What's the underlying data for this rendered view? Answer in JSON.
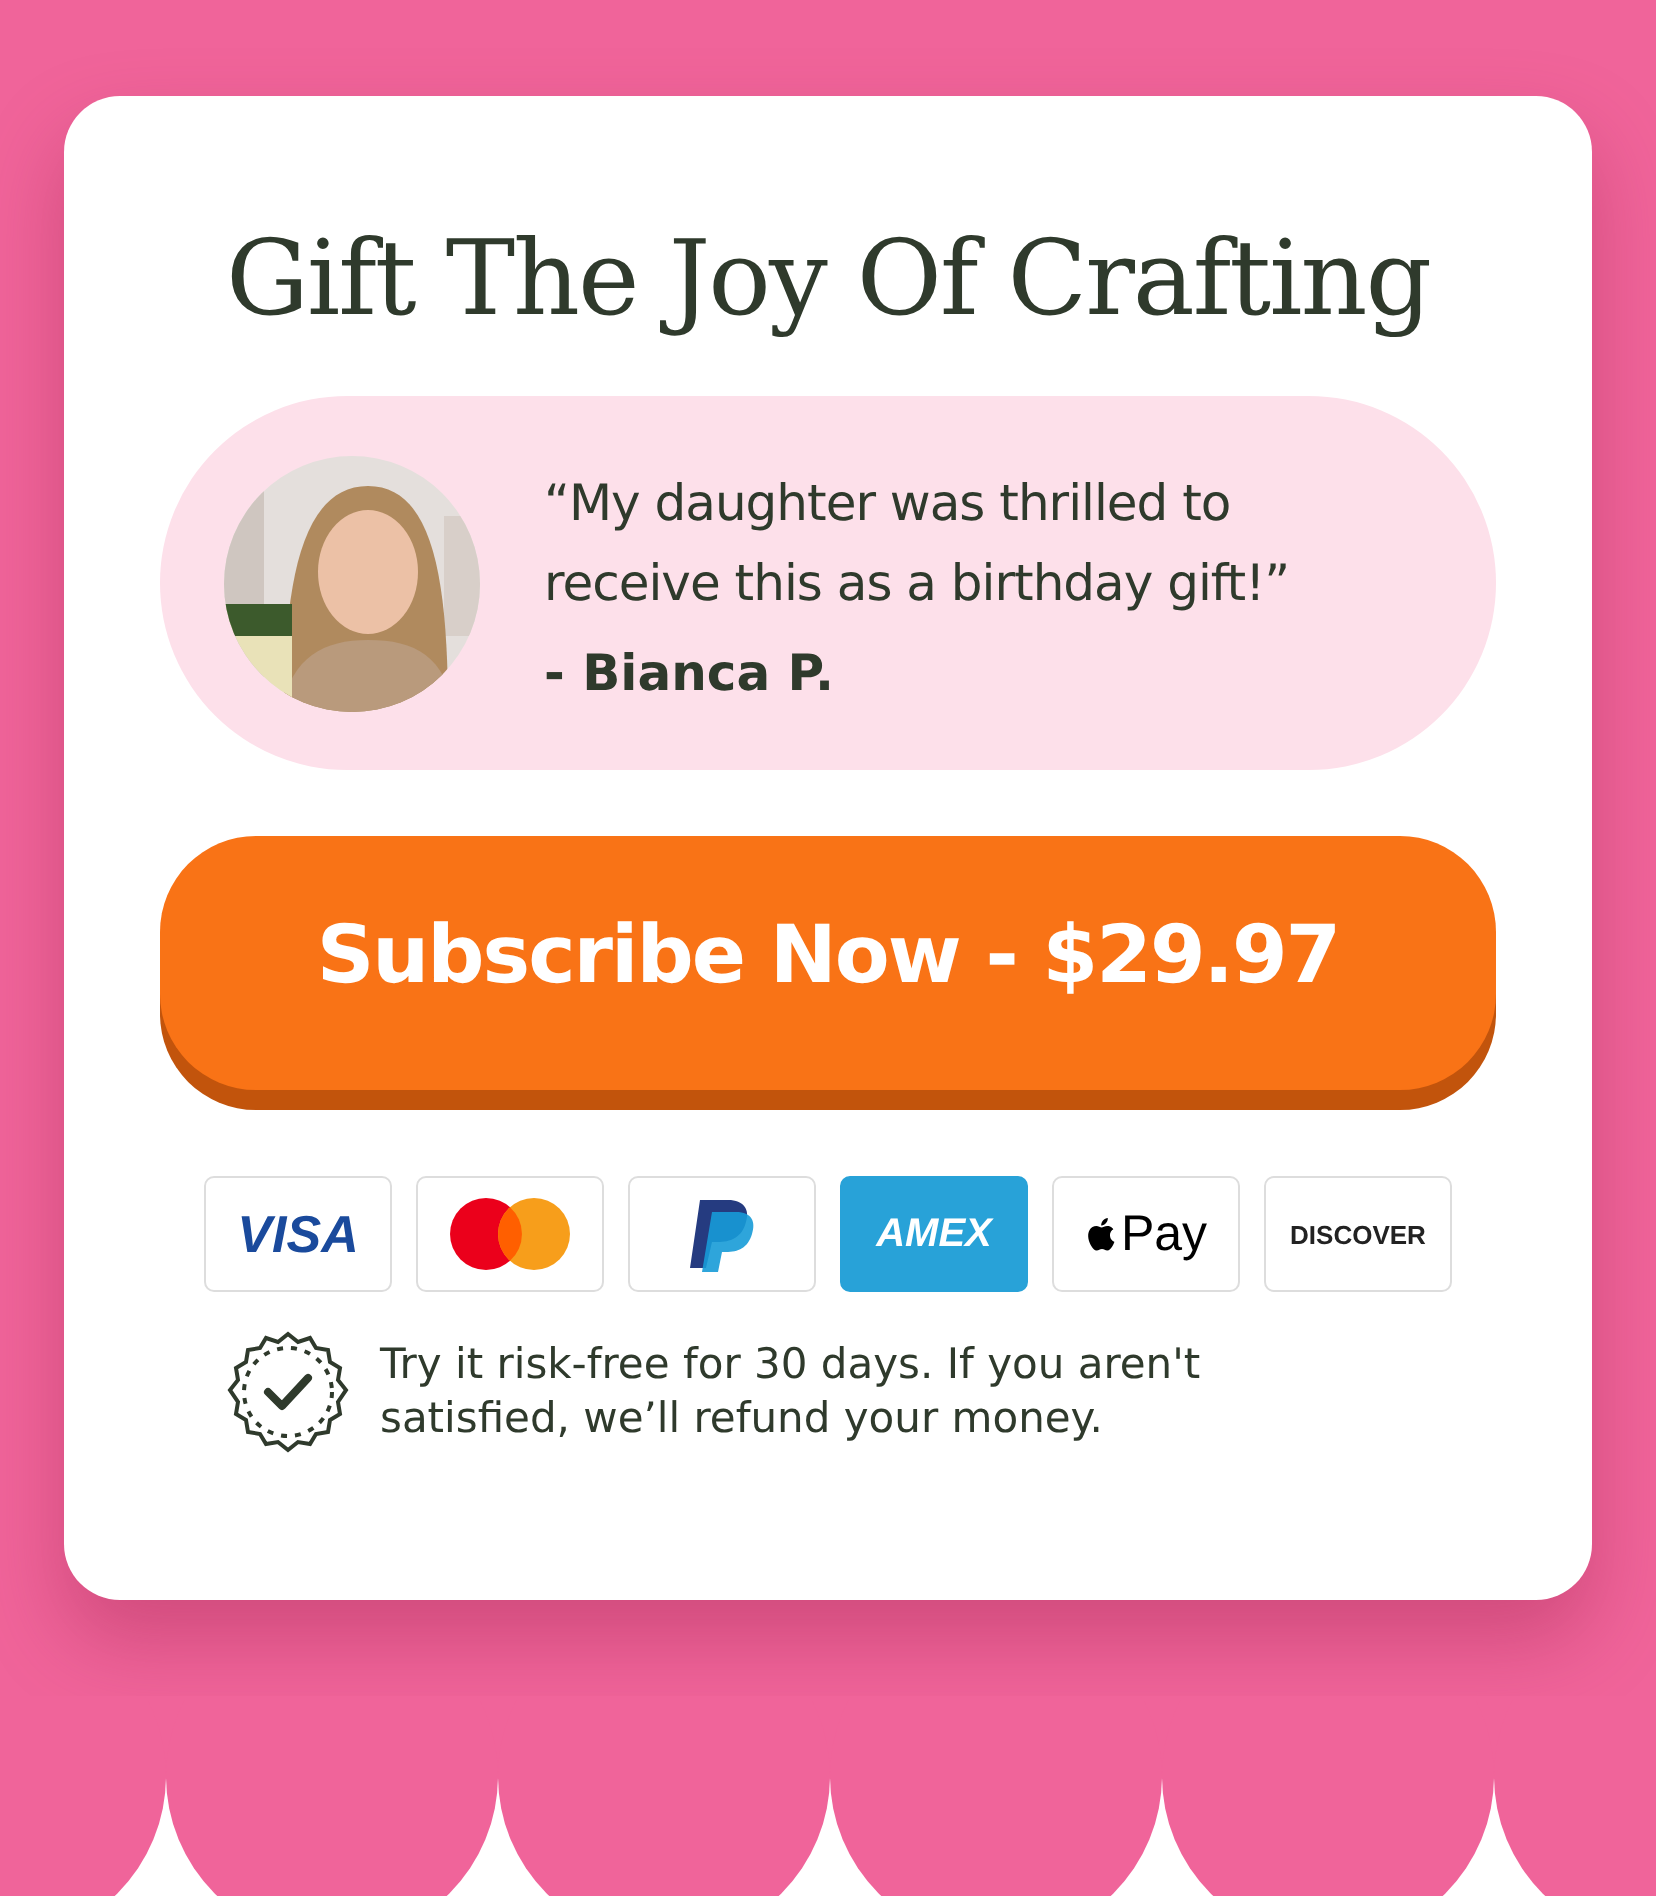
{
  "title": "Gift The Joy Of Crafting",
  "testimonial": {
    "quote": "“My daughter was thrilled to receive this as a birthday gift!”",
    "author": "- Bianca P."
  },
  "cta_button": "Subscribe Now - $29.97",
  "payment_methods": [
    {
      "kind": "visa",
      "label": "VISA"
    },
    {
      "kind": "mastercard"
    },
    {
      "kind": "paypal"
    },
    {
      "kind": "amex",
      "label": "AMEX"
    },
    {
      "kind": "applepay",
      "label": "Pay"
    },
    {
      "kind": "discover",
      "label": "DISCOVER"
    }
  ],
  "guarantee": "Try it risk-free for 30 days. If you aren't satisfied, we’ll refund your money."
}
